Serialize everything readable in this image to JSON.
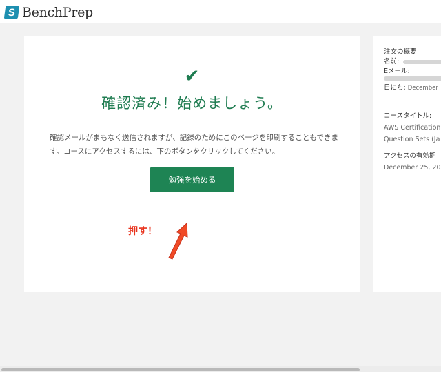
{
  "header": {
    "logo_mark": "S",
    "logo_text": "BenchPrep",
    "logo_icon": "benchprep-logo-icon"
  },
  "confirmation": {
    "check_glyph": "✔",
    "title": "確認済み！始めましょう。",
    "body": "確認メールがまもなく送信されますが、記録のためにこのページを印刷することもできます。コースにアクセスするには、下のボタンをクリックしてください。",
    "start_button": "勉強を始める",
    "annotation": "押す！"
  },
  "order_summary": {
    "title": "注文の概要",
    "name_label": "名前:",
    "email_label": "Eメール:",
    "date_label": "日にち:",
    "date_value": "December",
    "course_title_label": "コースタイトル:",
    "course_title_line1": "AWS Certification",
    "course_title_line2": "Question Sets (Ja",
    "expiry_label": "アクセスの有効期",
    "expiry_value": "December 25, 20"
  },
  "colors": {
    "accent_green": "#1e8454",
    "annotation_red": "#e8321c",
    "logo_blue": "#1d8fb0"
  }
}
